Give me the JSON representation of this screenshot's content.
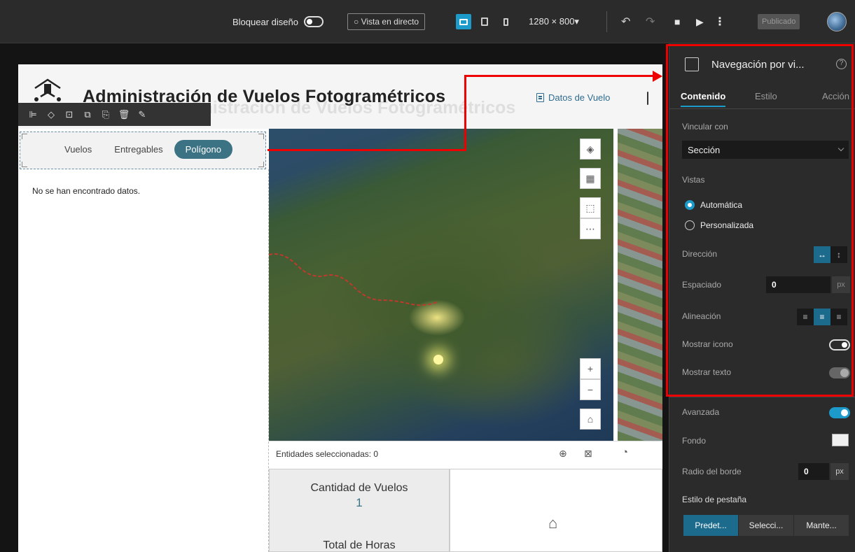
{
  "topbar": {
    "lock_layout_label": "Bloquear diseño",
    "live_view_label": "Vista en directo",
    "resolution": "1280 × 800▾",
    "publish_label": "Publicado"
  },
  "app": {
    "title": "Administración de Vuelos Fotogramétricos",
    "nav_item": "Datos de Vuelo"
  },
  "tabs": {
    "items": [
      "Vuelos",
      "Entregables",
      "Polígono"
    ],
    "active_index": 2
  },
  "left_panel": {
    "message": "No se han encontrado datos."
  },
  "map": {
    "selection_text": "Entidades seleccionadas: 0"
  },
  "stats": {
    "flights_label": "Cantidad de Vuelos",
    "flights_value": "1",
    "hours_label": "Total de Horas"
  },
  "panel": {
    "title": "Navegación por vi...",
    "tabs": [
      "Contenido",
      "Estilo",
      "Acción"
    ],
    "link_label": "Vincular con",
    "link_value": "Sección",
    "views_label": "Vistas",
    "view_auto": "Automática",
    "view_custom": "Personalizada",
    "direction_label": "Dirección",
    "spacing_label": "Espaciado",
    "spacing_value": "0",
    "spacing_unit": "px",
    "align_label": "Alineación",
    "show_icon_label": "Mostrar icono",
    "show_text_label": "Mostrar texto",
    "advanced_label": "Avanzada",
    "background_label": "Fondo",
    "radius_label": "Radio del borde",
    "radius_value": "0",
    "radius_unit": "px",
    "tab_style_label": "Estilo de pestaña",
    "tab_styles": [
      "Predet...",
      "Selecci...",
      "Mante..."
    ]
  },
  "colors": {
    "accent": "#1c9ac9",
    "tab_active": "#3b7385",
    "highlight": "#e00000"
  }
}
